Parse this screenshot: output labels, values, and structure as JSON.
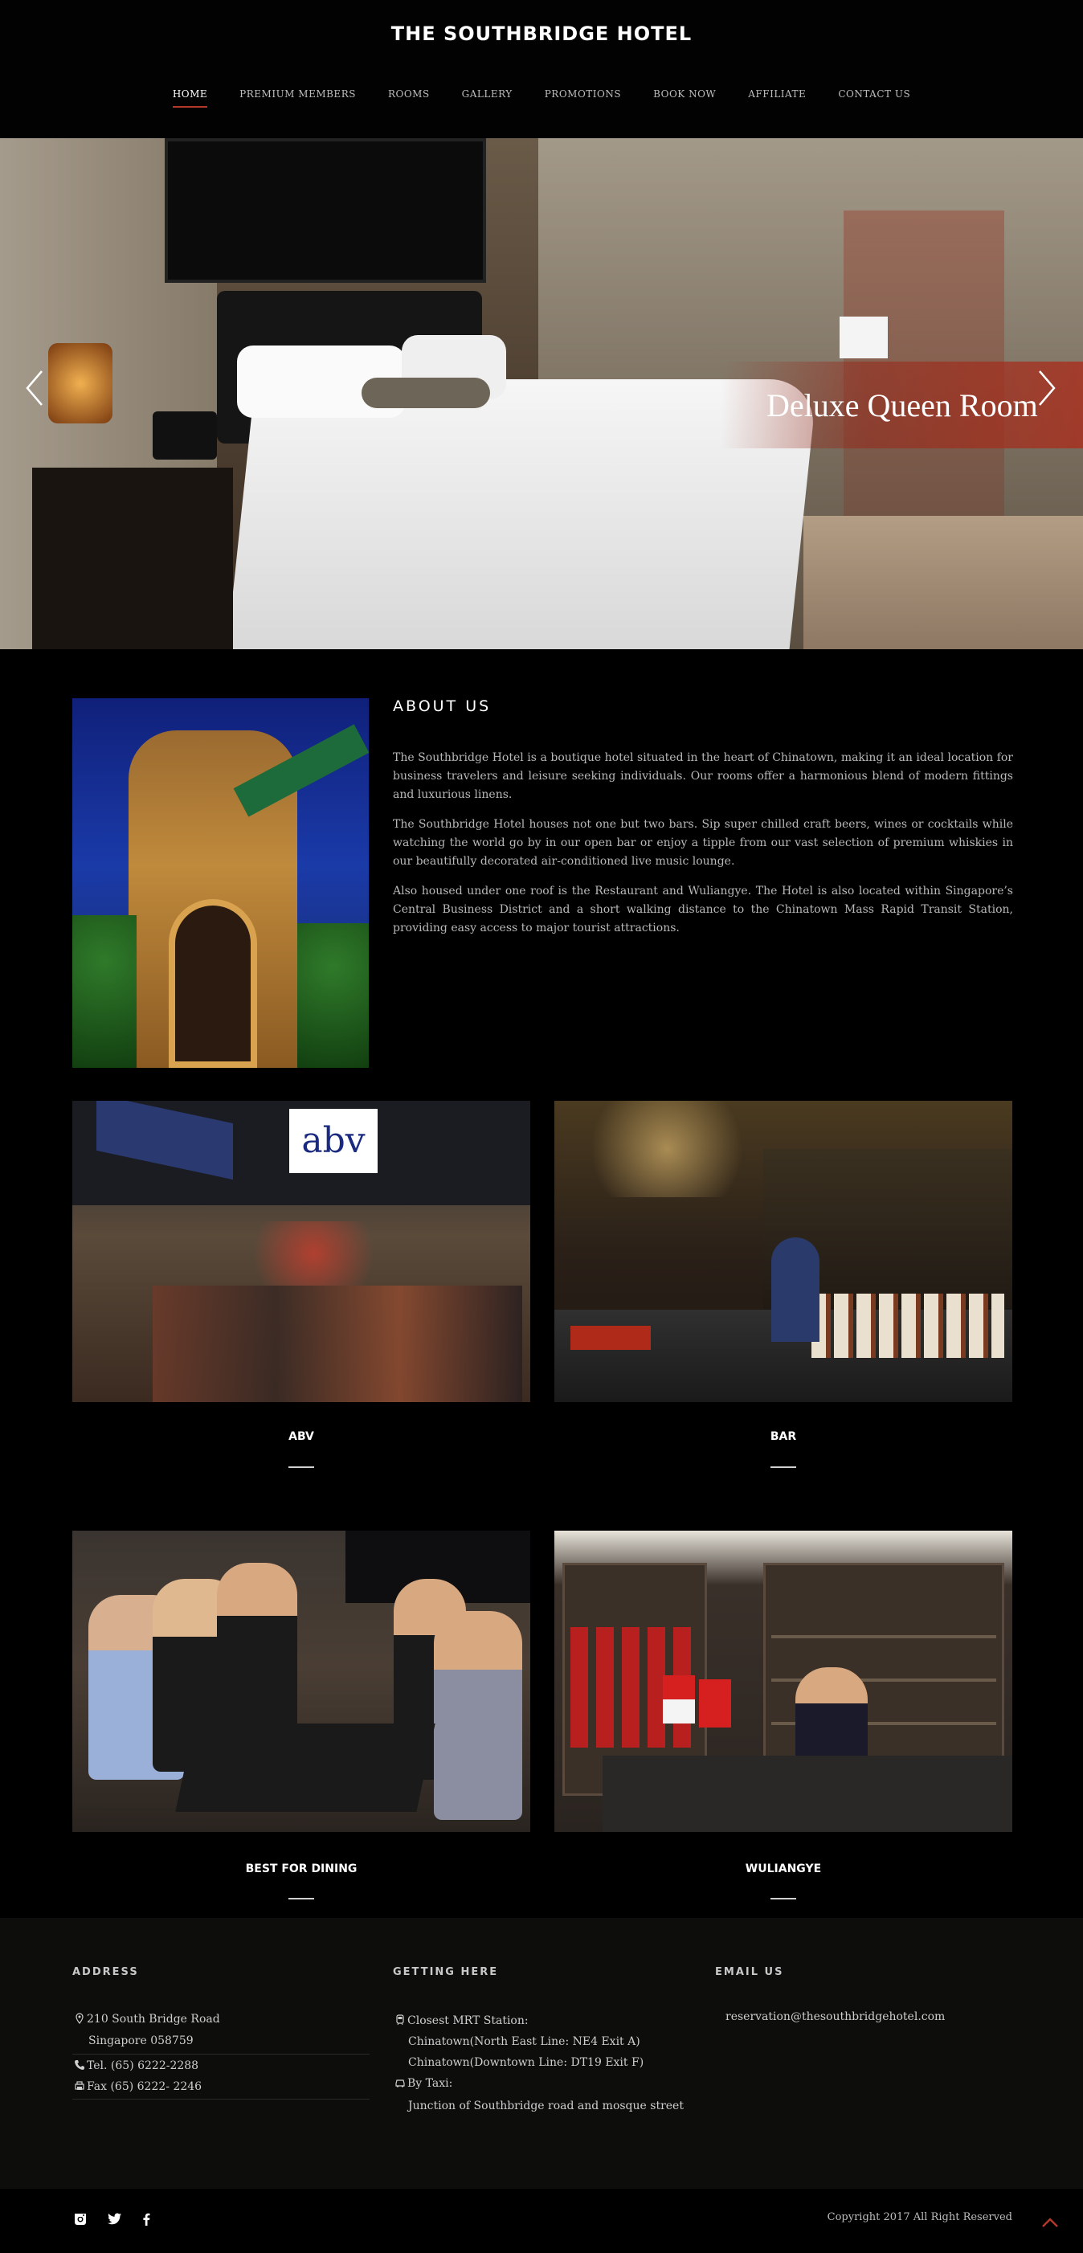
{
  "header": {
    "logo": "THE SOUTHBRIDGE HOTEL",
    "nav": [
      "HOME",
      "PREMIUM MEMBERS",
      "ROOMS",
      "GALLERY",
      "PROMOTIONS",
      "BOOK NOW",
      "AFFILIATE",
      "CONTACT US"
    ],
    "active_index": 0
  },
  "hero": {
    "caption": "Deluxe Queen Room"
  },
  "about": {
    "title": "ABOUT US",
    "paragraphs": [
      "The Southbridge Hotel is a boutique hotel situated in the heart of Chinatown, making it an ideal location for business travelers and leisure seeking individuals. Our rooms offer a harmonious blend of modern fittings and luxurious linens.",
      "The Southbridge Hotel houses not one but two bars. Sip super chilled craft beers, wines or cocktails while watching the world go by in our open bar or enjoy a tipple from our vast selection of premium whiskies in our beautifully decorated air-conditioned live music lounge.",
      "Also housed under one roof is the Restaurant and Wuliangye. The Hotel is also located within Singapore’s Central Business District and a short walking distance to the Chinatown Mass Rapid Transit Station, providing easy access to major tourist attractions."
    ]
  },
  "cards": [
    {
      "title": "ABV",
      "sign": "abv"
    },
    {
      "title": "BAR"
    },
    {
      "title": "BEST FOR DINING"
    },
    {
      "title": "WULIANGYE"
    }
  ],
  "footer": {
    "address": {
      "title": "ADDRESS",
      "line1": "210 South Bridge Road",
      "line2": "Singapore 058759",
      "tel": "Tel. (65) 6222-2288",
      "fax": "Fax (65) 6222- 2246"
    },
    "getting_here": {
      "title": "GETTING HERE",
      "mrt_label": "Closest MRT Station:",
      "mrt1": "Chinatown(North East Line: NE4 Exit A)",
      "mrt2": "Chinatown(Downtown Line: DT19 Exit F)",
      "taxi_label": "By Taxi:",
      "taxi": "Junction of Southbridge road and mosque street"
    },
    "email": {
      "title": "EMAIL US",
      "address": "reservation@thesouthbridgehotel.com"
    },
    "copyright": "Copyright 2017 All Right Reserved",
    "social_icons": [
      "instagram-icon",
      "twitter-icon",
      "facebook-icon"
    ]
  },
  "colors": {
    "accent": "#b23a2b",
    "background": "#000000",
    "footer_bg": "#0d0d0b"
  }
}
